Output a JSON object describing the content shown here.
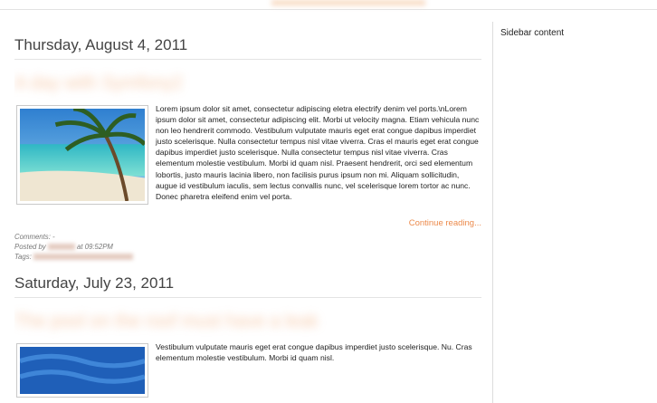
{
  "sidebar": {
    "text": "Sidebar content"
  },
  "posts": [
    {
      "date": "Thursday, August 4, 2011",
      "title": "A day with Symfony2",
      "body": "Lorem ipsum dolor sit amet, consectetur adipiscing eletra electrify denim vel ports.\\nLorem ipsum dolor sit amet, consectetur adipiscing elit. Morbi ut velocity magna. Etiam vehicula nunc non leo hendrerit commodo. Vestibulum vulputate mauris eget erat congue dapibus imperdiet justo scelerisque. Nulla consectetur tempus nisl vitae viverra. Cras el mauris eget erat congue dapibus imperdiet justo scelerisque. Nulla consectetur tempus nisl vitae viverra. Cras elementum molestie vestibulum. Morbi id quam nisl. Praesent hendrerit, orci sed elementum lobortis, justo mauris lacinia libero, non facilisis purus ipsum non mi. Aliquam sollicitudin, augue id vestibulum iaculis, sem lectus convallis nunc, vel scelerisque lorem tortor ac nunc. Donec pharetra eleifend enim vel porta.",
      "continue_label": "Continue reading...",
      "comments_label": "Comments: -",
      "posted_by_label": "Posted by",
      "posted_at": "at 09:52PM",
      "tags_label": "Tags:"
    },
    {
      "date": "Saturday, July 23, 2011",
      "title": "The pool on the roof must have a leak",
      "body": "Vestibulum vulputate mauris eget erat congue dapibus imperdiet justo scelerisque. Nu. Cras elementum molestie vestibulum. Morbi id quam nisl."
    }
  ]
}
